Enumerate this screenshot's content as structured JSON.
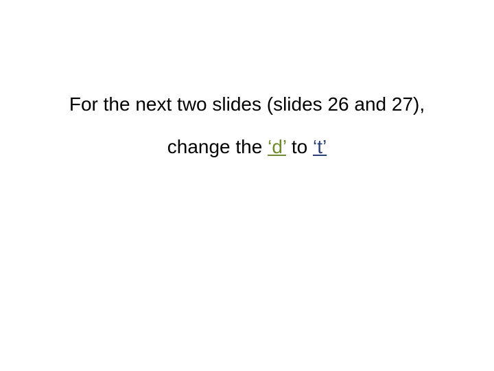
{
  "line1": "For the next two slides (slides 26 and 27),",
  "line2_prefix": "change the ",
  "line2_d": "‘d’",
  "line2_middle": " to ",
  "line2_t": "‘t’"
}
